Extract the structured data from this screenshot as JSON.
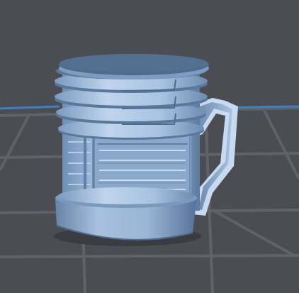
{
  "scene": {
    "object": "mug-model",
    "colors": {
      "background": "#4b4d52",
      "grid_line": "#606267",
      "axis_x": "#3d7fc4",
      "axis_y": "#3aa45a",
      "model_base": "#8eaed0",
      "model_light": "#c6daf0",
      "model_dark": "#4f6c8e"
    }
  }
}
